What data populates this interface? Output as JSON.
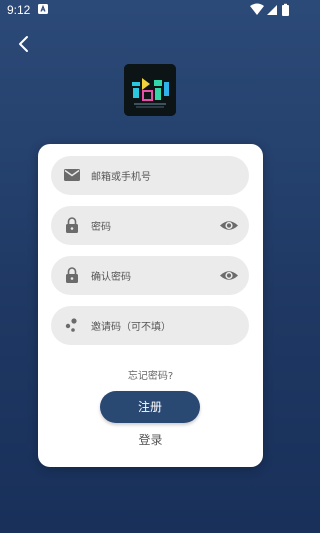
{
  "status_bar": {
    "time": "9:12"
  },
  "form": {
    "email_placeholder": "邮箱或手机号",
    "password_placeholder": "密码",
    "confirm_password_placeholder": "确认密码",
    "invite_code_placeholder": "邀请码（可不填）"
  },
  "links": {
    "forgot_password": "忘记密码?",
    "login": "登录"
  },
  "buttons": {
    "register": "注册"
  },
  "icons": {
    "back": "chevron-left-icon",
    "email": "mail-icon",
    "password": "lock-icon",
    "confirm_password": "lock-icon",
    "invite_code": "dots-icon",
    "visibility": "eye-icon"
  },
  "colors": {
    "background": "#1f3964",
    "primary_button": "#294872",
    "card": "#ffffff",
    "field": "#ebebeb"
  }
}
